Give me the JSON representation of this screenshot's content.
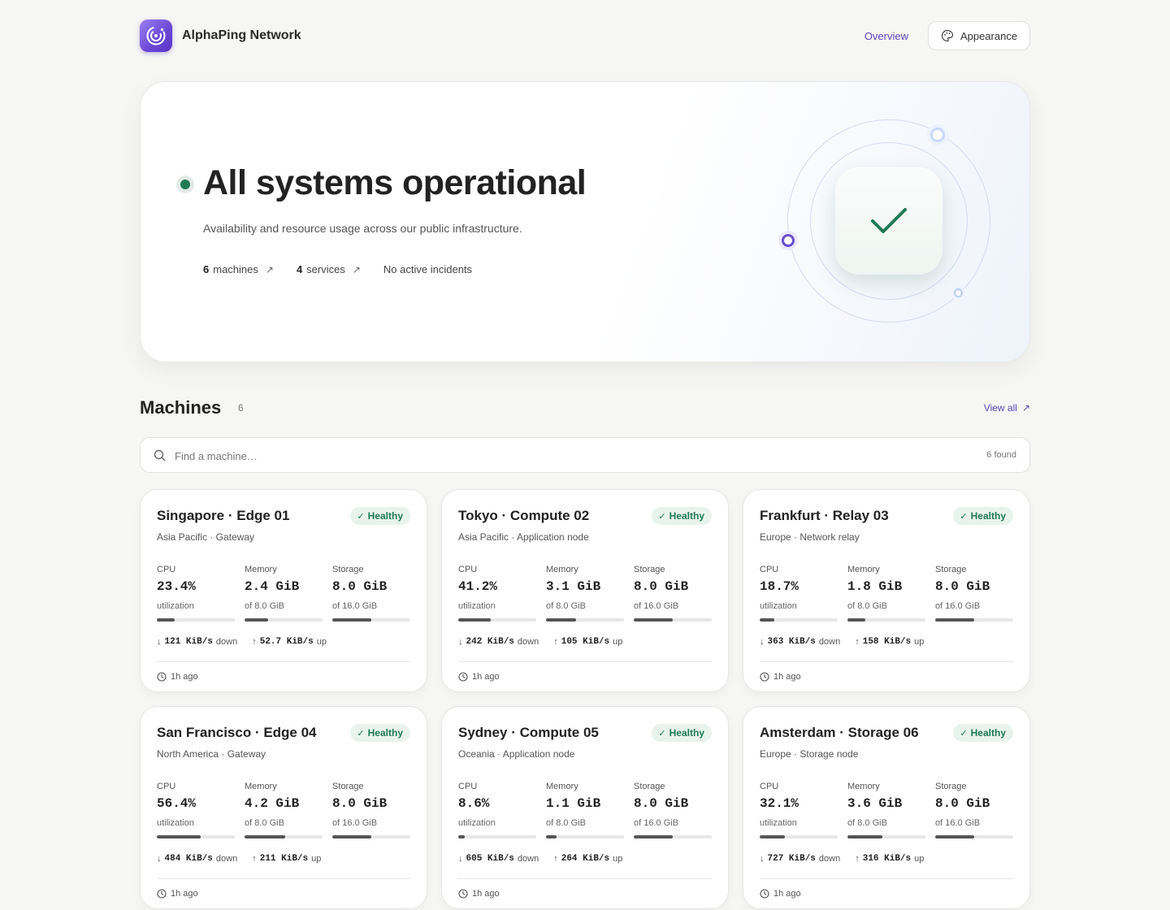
{
  "header": {
    "brand": "AlphaPing Network",
    "nav_overview": "Overview",
    "appearance_label": "Appearance"
  },
  "hero": {
    "title": "All systems operational",
    "subtitle": "Availability and resource usage across our public infrastructure.",
    "machines_count": "6",
    "machines_label": "machines",
    "services_count": "4",
    "services_label": "services",
    "incidents": "No active incidents"
  },
  "machines": {
    "title": "Machines",
    "count": "6",
    "view_all": "View all",
    "search_placeholder": "Find a machine…",
    "found": "6 found",
    "cards": [
      {
        "name": "Singapore · Edge 01",
        "region": "Asia Pacific · Gateway",
        "status": "Healthy",
        "cpu_label": "CPU",
        "cpu": "23.4%",
        "cpu_sub": "utilization",
        "cpu_pct": 23.4,
        "mem_label": "Memory",
        "mem": "2.4 GiB",
        "mem_sub": "of 8.0 GiB",
        "mem_pct": 30,
        "sto_label": "Storage",
        "sto": "8.0 GiB",
        "sto_sub": "of 16.0 GiB",
        "sto_pct": 50,
        "down": "121 KiB/s",
        "down_label": "down",
        "up": "52.7 KiB/s",
        "up_label": "up",
        "updated": "1h ago"
      },
      {
        "name": "Tokyo · Compute 02",
        "region": "Asia Pacific · Application node",
        "status": "Healthy",
        "cpu_label": "CPU",
        "cpu": "41.2%",
        "cpu_sub": "utilization",
        "cpu_pct": 41.2,
        "mem_label": "Memory",
        "mem": "3.1 GiB",
        "mem_sub": "of 8.0 GiB",
        "mem_pct": 38.75,
        "sto_label": "Storage",
        "sto": "8.0 GiB",
        "sto_sub": "of 16.0 GiB",
        "sto_pct": 50,
        "down": "242 KiB/s",
        "down_label": "down",
        "up": "105 KiB/s",
        "up_label": "up",
        "updated": "1h ago"
      },
      {
        "name": "Frankfurt · Relay 03",
        "region": "Europe · Network relay",
        "status": "Healthy",
        "cpu_label": "CPU",
        "cpu": "18.7%",
        "cpu_sub": "utilization",
        "cpu_pct": 18.7,
        "mem_label": "Memory",
        "mem": "1.8 GiB",
        "mem_sub": "of 8.0 GiB",
        "mem_pct": 22.5,
        "sto_label": "Storage",
        "sto": "8.0 GiB",
        "sto_sub": "of 16.0 GiB",
        "sto_pct": 50,
        "down": "363 KiB/s",
        "down_label": "down",
        "up": "158 KiB/s",
        "up_label": "up",
        "updated": "1h ago"
      },
      {
        "name": "San Francisco · Edge 04",
        "region": "North America · Gateway",
        "status": "Healthy",
        "cpu_label": "CPU",
        "cpu": "56.4%",
        "cpu_sub": "utilization",
        "cpu_pct": 56.4,
        "mem_label": "Memory",
        "mem": "4.2 GiB",
        "mem_sub": "of 8.0 GiB",
        "mem_pct": 52.5,
        "sto_label": "Storage",
        "sto": "8.0 GiB",
        "sto_sub": "of 16.0 GiB",
        "sto_pct": 50,
        "down": "484 KiB/s",
        "down_label": "down",
        "up": "211 KiB/s",
        "up_label": "up",
        "updated": "1h ago"
      },
      {
        "name": "Sydney · Compute 05",
        "region": "Oceania · Application node",
        "status": "Healthy",
        "cpu_label": "CPU",
        "cpu": "8.6%",
        "cpu_sub": "utilization",
        "cpu_pct": 8.6,
        "mem_label": "Memory",
        "mem": "1.1 GiB",
        "mem_sub": "of 8.0 GiB",
        "mem_pct": 13.75,
        "sto_label": "Storage",
        "sto": "8.0 GiB",
        "sto_sub": "of 16.0 GiB",
        "sto_pct": 50,
        "down": "605 KiB/s",
        "down_label": "down",
        "up": "264 KiB/s",
        "up_label": "up",
        "updated": "1h ago"
      },
      {
        "name": "Amsterdam · Storage 06",
        "region": "Europe · Storage node",
        "status": "Healthy",
        "cpu_label": "CPU",
        "cpu": "32.1%",
        "cpu_sub": "utilization",
        "cpu_pct": 32.1,
        "mem_label": "Memory",
        "mem": "3.6 GiB",
        "mem_sub": "of 8.0 GiB",
        "mem_pct": 45,
        "sto_label": "Storage",
        "sto": "8.0 GiB",
        "sto_sub": "of 16.0 GiB",
        "sto_pct": 50,
        "down": "727 KiB/s",
        "down_label": "down",
        "up": "316 KiB/s",
        "up_label": "up",
        "updated": "1h ago"
      }
    ]
  },
  "colors": {
    "accent": "#5b45b8",
    "healthy": "#1f7a55",
    "healthy_bg": "#e9f3ee",
    "background": "#f6f6f4"
  },
  "icons": {
    "logo": "radar-icon",
    "appearance": "palette-icon",
    "search": "search-icon",
    "check": "check-icon",
    "down": "arrow-down-icon",
    "up": "arrow-up-icon",
    "clock": "clock-icon",
    "external": "arrow-up-right-icon"
  }
}
